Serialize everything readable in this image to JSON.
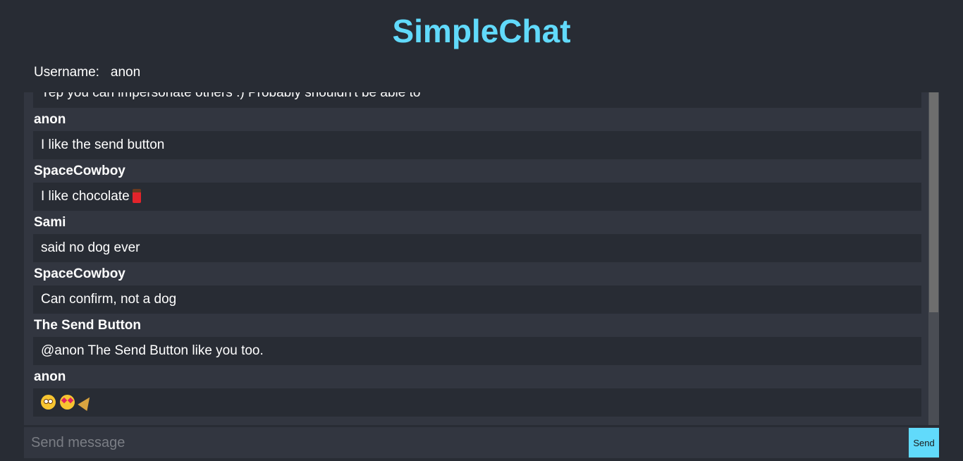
{
  "app": {
    "title": "SimpleChat",
    "accent_color": "#61dafb",
    "background_color": "#282c34"
  },
  "username": {
    "label": "Username:",
    "value": "anon"
  },
  "messages": [
    {
      "author": "",
      "text": "Yep you can impersonate others :) Probably shouldn't be able to"
    },
    {
      "author": "anon",
      "text": "I like the send button"
    },
    {
      "author": "SpaceCowboy",
      "text": "I like chocolate",
      "emoji": "chocolate-bar-icon"
    },
    {
      "author": "Sami",
      "text": "said no dog ever"
    },
    {
      "author": "SpaceCowboy",
      "text": "Can confirm, not a dog"
    },
    {
      "author": "The Send Button",
      "text": "@anon The Send Button like you too."
    },
    {
      "author": "anon",
      "text": "",
      "emoji": [
        "flushed-face-icon",
        "heart-eyes-face-icon",
        "party-popper-icon"
      ]
    }
  ],
  "composer": {
    "placeholder": "Send message",
    "value": "",
    "send_label": "Send"
  }
}
